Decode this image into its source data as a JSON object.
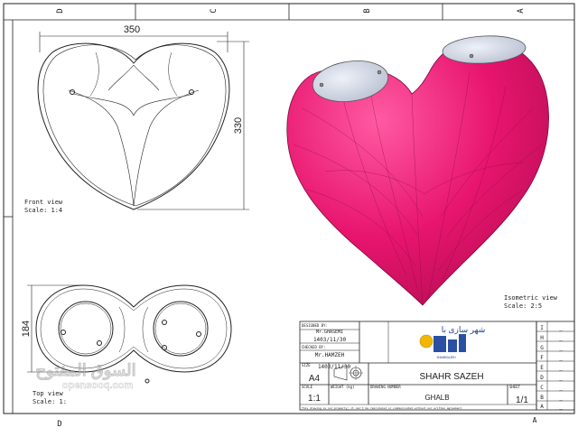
{
  "frame": {
    "top_zones": [
      "D",
      "C",
      "B",
      "A"
    ],
    "bottom_zones": [
      "D",
      "A"
    ],
    "right_rows": [
      "I",
      "H",
      "G",
      "F",
      "E",
      "D",
      "C",
      "B",
      "A"
    ]
  },
  "front_view": {
    "label": "Front view",
    "scale": "Scale:  1:4",
    "dim_width": "350",
    "dim_height": "330"
  },
  "top_view": {
    "label": "Top view",
    "scale": "Scale:  1:",
    "dim_height": "184"
  },
  "isometric_view": {
    "label": "Isometric view",
    "scale": "Scale:  2:5"
  },
  "title_block": {
    "designed_by_label": "DESIGNED BY:",
    "designed_by": "Mr.GHASEMI",
    "checked_by_label": "CHECKED BY:",
    "checked_by": "Mr.HAMZEH",
    "date_1": "1403/11/30",
    "date_2": "1403/11/30",
    "date_label": "DATE",
    "size_label": "SIZE",
    "size": "A4",
    "scale_label": "SCALE",
    "scale": "1:1",
    "weight_label": "WEIGHT (kg)",
    "drawing_number_label": "DRAWING NUMBER",
    "drawing_number": "GHALB",
    "sheet_label": "SHEET",
    "sheet": "1/1",
    "company": "SHAHR SAZEH",
    "logo_text": "شهر سازی با",
    "logo_subtext": "SHAHRSAZEH",
    "notice": "This drawing is our property; it can't be reproduced or communicated without our written agreement."
  },
  "revision_marks": [
    "_",
    "_",
    "_",
    "_",
    "_",
    "_",
    "_",
    "_",
    "_"
  ],
  "watermark": {
    "arabic": "السوق المفتوح",
    "latin": "opensooq.com"
  },
  "colors": {
    "heart": "#e8156e",
    "caps": "#d6dbe8",
    "lines": "#222222"
  }
}
